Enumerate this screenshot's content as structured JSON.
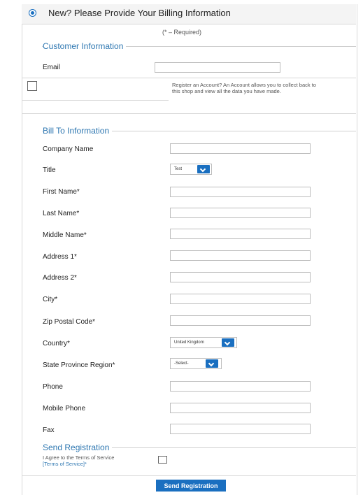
{
  "header": {
    "title": "New? Please Provide Your Billing Information"
  },
  "required_note": "(* – Required)",
  "customer": {
    "title": "Customer Information",
    "email_label": "Email",
    "register_note": "Register an Account? An Account allows you to collect back to this shop and view all the data you have made."
  },
  "bill": {
    "title": "Bill To Information",
    "company_label": "Company Name",
    "title_label": "Title",
    "title_value": "Test",
    "first_label": "First Name*",
    "last_label": "Last Name*",
    "middle_label": "Middle Name*",
    "address1_label": "Address 1*",
    "address2_label": "Address 2*",
    "city_label": "City*",
    "zip_label": "Zip Postal Code*",
    "country_label": "Country*",
    "country_value": "United Kingdom",
    "state_label": "State Province Region*",
    "state_value": "-Select-",
    "phone_label": "Phone",
    "mobile_label": "Mobile Phone",
    "fax_label": "Fax"
  },
  "send": {
    "title": "Send Registration",
    "agree_text": "I Agree to the Terms of Service",
    "terms_link": "[Terms of Service]*",
    "button_label": "Send Registration"
  }
}
